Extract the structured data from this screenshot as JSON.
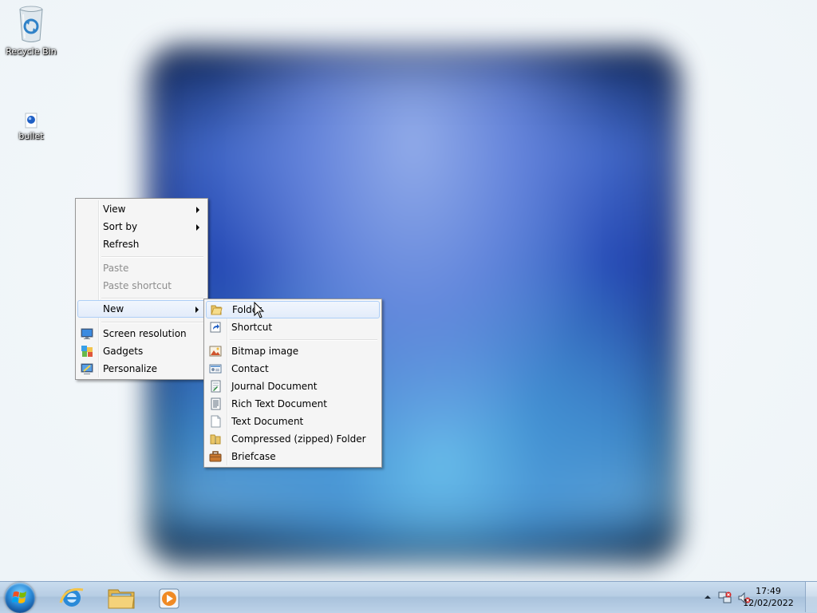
{
  "desktop": {
    "icons": [
      {
        "label": "Recycle Bin",
        "icon": "recycle-bin-icon"
      },
      {
        "label": "bullet",
        "icon": "bullet-file-icon"
      }
    ]
  },
  "context_menu": {
    "items": [
      {
        "label": "View",
        "submenu": true,
        "enabled": true
      },
      {
        "label": "Sort by",
        "submenu": true,
        "enabled": true
      },
      {
        "label": "Refresh",
        "enabled": true
      },
      {
        "label": "Paste",
        "enabled": false
      },
      {
        "label": "Paste shortcut",
        "enabled": false
      },
      {
        "label": "New",
        "submenu": true,
        "enabled": true,
        "highlighted": true
      },
      {
        "label": "Screen resolution",
        "icon": "screen-resolution-icon",
        "enabled": true
      },
      {
        "label": "Gadgets",
        "icon": "gadgets-icon",
        "enabled": true
      },
      {
        "label": "Personalize",
        "icon": "personalize-icon",
        "enabled": true
      }
    ]
  },
  "new_submenu": {
    "items": [
      {
        "label": "Folder",
        "icon": "folder-icon",
        "highlighted": true
      },
      {
        "label": "Shortcut",
        "icon": "shortcut-icon"
      },
      {
        "label": "Bitmap image",
        "icon": "bitmap-image-icon"
      },
      {
        "label": "Contact",
        "icon": "contact-icon"
      },
      {
        "label": "Journal Document",
        "icon": "journal-document-icon"
      },
      {
        "label": "Rich Text Document",
        "icon": "rich-text-document-icon"
      },
      {
        "label": "Text Document",
        "icon": "text-document-icon"
      },
      {
        "label": "Compressed (zipped) Folder",
        "icon": "zipped-folder-icon"
      },
      {
        "label": "Briefcase",
        "icon": "briefcase-icon"
      }
    ]
  },
  "taskbar": {
    "pinned": [
      "internet-explorer-icon",
      "windows-explorer-icon",
      "media-player-icon"
    ],
    "tray_icons": [
      "show-hidden-icons-arrow",
      "network-icon",
      "volume-muted-icon"
    ],
    "clock": {
      "time": "17:49",
      "date": "12/02/2022"
    }
  }
}
